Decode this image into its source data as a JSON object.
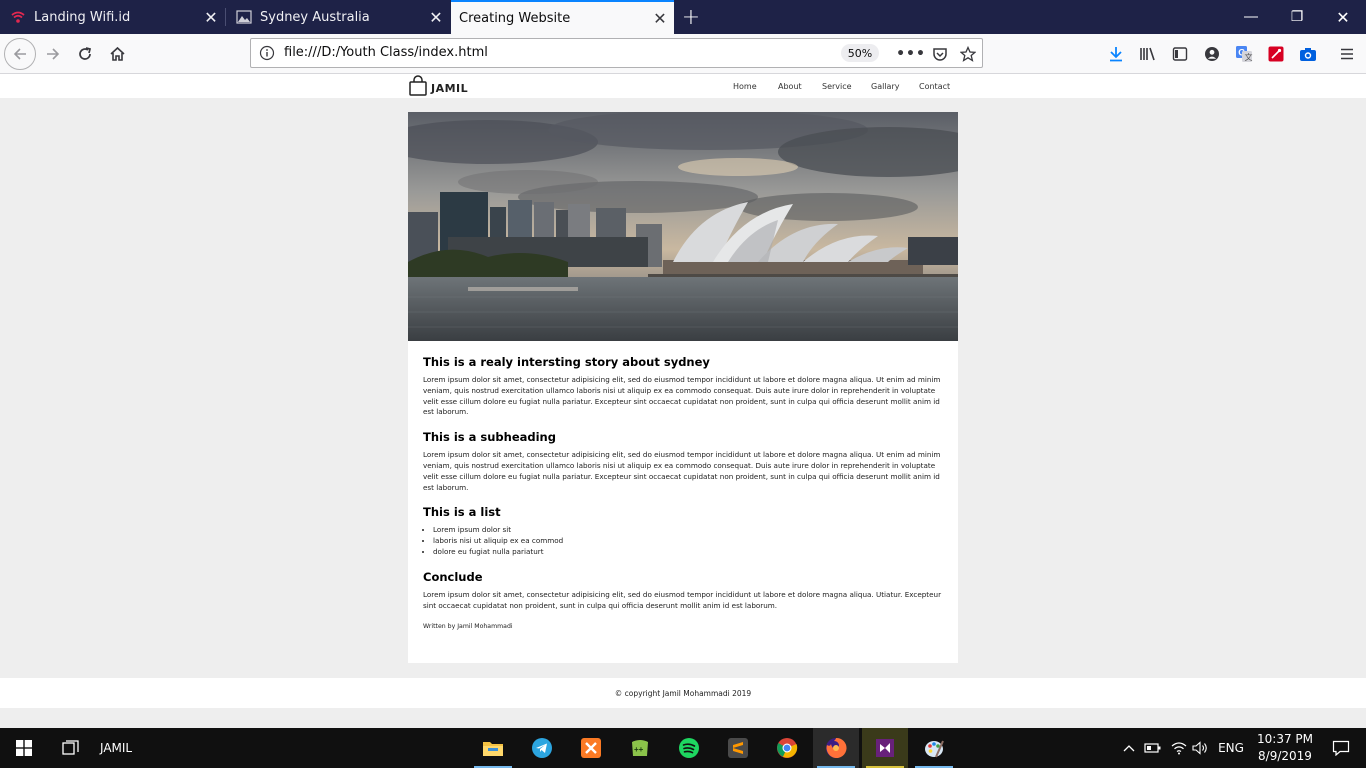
{
  "browser": {
    "tabs": [
      {
        "label": "Landing Wifi.id",
        "icon": "wifi-icon",
        "active": false
      },
      {
        "label": "Sydney Australia",
        "icon": "page-image-icon",
        "active": false
      },
      {
        "label": "Creating Website",
        "icon": "",
        "active": true
      }
    ],
    "url": "file:///D:/Youth Class/index.html",
    "zoom": "50%",
    "accent": "#0a84ff",
    "tabbar_color": "#1e2247"
  },
  "site": {
    "brand": "JAMIL",
    "nav": [
      "Home",
      "About",
      "Service",
      "Gallary",
      "Contact"
    ],
    "sections": [
      {
        "heading": "This is a realy intersting story about sydney",
        "body": "Lorem ipsum dolor sit amet, consectetur adipisicing elit, sed do eiusmod tempor incididunt ut labore et dolore magna aliqua. Ut enim ad minim veniam, quis nostrud exercitation ullamco laboris nisi ut aliquip ex ea commodo consequat. Duis aute irure dolor in reprehenderit in voluptate velit esse cillum dolore eu fugiat nulla pariatur. Excepteur sint occaecat cupidatat non proident, sunt in culpa qui officia deserunt mollit anim id est laborum."
      },
      {
        "heading": "This is a subheading",
        "body": "Lorem ipsum dolor sit amet, consectetur adipisicing elit, sed do eiusmod tempor incididunt ut labore et dolore magna aliqua. Ut enim ad minim veniam, quis nostrud exercitation ullamco laboris nisi ut aliquip ex ea commodo consequat. Duis aute irure dolor in reprehenderit in voluptate velit esse cillum dolore eu fugiat nulla pariatur. Excepteur sint occaecat cupidatat non proident, sunt in culpa qui officia deserunt mollit anim id est laborum."
      },
      {
        "heading": "This is a list",
        "list": [
          "Lorem ipsum dolor sit",
          "laboris nisi ut aliquip ex ea commod",
          "dolore eu fugiat nulla pariaturt"
        ]
      },
      {
        "heading": "Conclude",
        "body": "Lorem ipsum dolor sit amet, consectetur adipisicing elit, sed do eiusmod tempor incididunt ut labore et dolore magna aliqua. Utiatur. Excepteur sint occaecat cupidatat non proident, sunt in culpa qui officia deserunt mollit anim id est laborum."
      }
    ],
    "byline": "Written by Jamil Mohammadi",
    "footer": "© copyright Jamil Mohammadi 2019"
  },
  "taskbar": {
    "label": "JAMIL",
    "apps": [
      "file-explorer-icon",
      "telegram-icon",
      "xampp-icon",
      "notepad-plus-icon",
      "spotify-icon",
      "sublime-text-icon",
      "chrome-icon",
      "firefox-icon",
      "visual-studio-icon",
      "paint-icon"
    ],
    "language": "ENG",
    "time": "10:37 PM",
    "date": "8/9/2019"
  }
}
